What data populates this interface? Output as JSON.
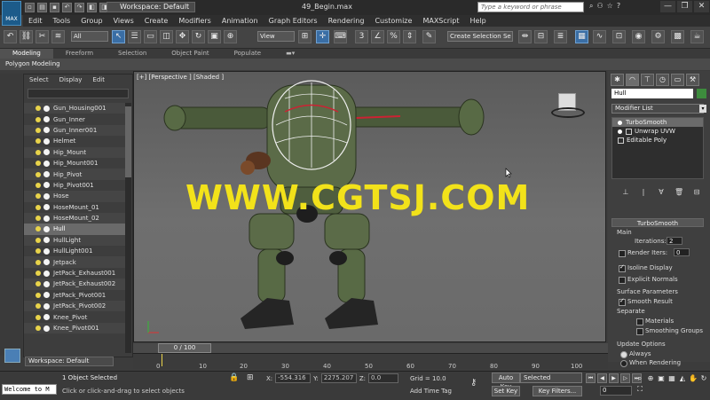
{
  "titlebar": {
    "logo_text": "MAX",
    "workspace": "Workspace: Default",
    "file_title": "49_Begin.max",
    "search_placeholder": "Type a keyword or phrase",
    "window_buttons": [
      "—",
      "❐",
      "✕"
    ]
  },
  "menu": [
    "Edit",
    "Tools",
    "Group",
    "Views",
    "Create",
    "Modifiers",
    "Animation",
    "Graph Editors",
    "Rendering",
    "Customize",
    "MAXScript",
    "Help"
  ],
  "toolbar": {
    "filter_dropdown": "All",
    "refcoord_dropdown": "View",
    "selection_set": "Create Selection Se"
  },
  "ribbon": {
    "tabs": [
      "Modeling",
      "Freeform",
      "Selection",
      "Object Paint",
      "Populate"
    ],
    "active_tab": "Modeling",
    "subpanel": "Polygon Modeling"
  },
  "explorer": {
    "menu": [
      "Select",
      "Display",
      "Edit"
    ],
    "items": [
      "Gun_Housing001",
      "Gun_Inner",
      "Gun_Inner001",
      "Helmet",
      "Hip_Mount",
      "Hip_Mount001",
      "Hip_Pivot",
      "Hip_Pivot001",
      "Hose",
      "HoseMount_01",
      "HoseMount_02",
      "Hull",
      "HullLight",
      "HullLight001",
      "Jetpack",
      "JetPack_Exhaust001",
      "JetPack_Exhaust002",
      "JetPack_Pivot001",
      "JetPack_Pivot002",
      "Knee_Pivot",
      "Knee_Pivot001"
    ],
    "selected": "Hull",
    "workspace_bottom": "Workspace: Default"
  },
  "viewport": {
    "label": "[+] [Perspective ] [Shaded ]",
    "watermark": "WWW.CGTSJ.COM"
  },
  "command_panel": {
    "object_name": "Hull",
    "modifier_list": "Modifier List",
    "stack": [
      "TurboSmooth",
      "Unwrap UVW",
      "Editable Poly"
    ],
    "rollout": {
      "title": "TurboSmooth",
      "main_group": "Main",
      "iterations_label": "Iterations:",
      "iterations_value": "2",
      "render_iters_label": "Render Iters:",
      "render_iters_value": "0",
      "isoline_label": "Isoline Display",
      "explicit_label": "Explicit Normals",
      "surface_group": "Surface Parameters",
      "smooth_result_label": "Smooth Result",
      "separate_label": "Separate",
      "materials_label": "Materials",
      "smoothing_groups_label": "Smoothing Groups",
      "update_group": "Update Options",
      "always_label": "Always",
      "when_rendering_label": "When Rendering"
    }
  },
  "timeline": {
    "slider_label": "0 / 100",
    "ticks": [
      "0",
      "10",
      "20",
      "30",
      "40",
      "50",
      "60",
      "70",
      "80",
      "90",
      "100"
    ]
  },
  "status": {
    "maxscript": "Welcome to M",
    "line1": "1 Object Selected",
    "line2": "Click or click-and-drag to select objects",
    "x_label": "X:",
    "x_value": "-554.316",
    "y_label": "Y:",
    "y_value": "2275.207",
    "z_label": "Z:",
    "z_value": "0.0",
    "grid": "Grid = 10.0",
    "add_time_tag": "Add Time Tag",
    "auto_key": "Auto Key",
    "set_key": "Set Key",
    "selected_dropdown": "Selected",
    "key_filters": "Key Filters...",
    "frame": "0"
  }
}
